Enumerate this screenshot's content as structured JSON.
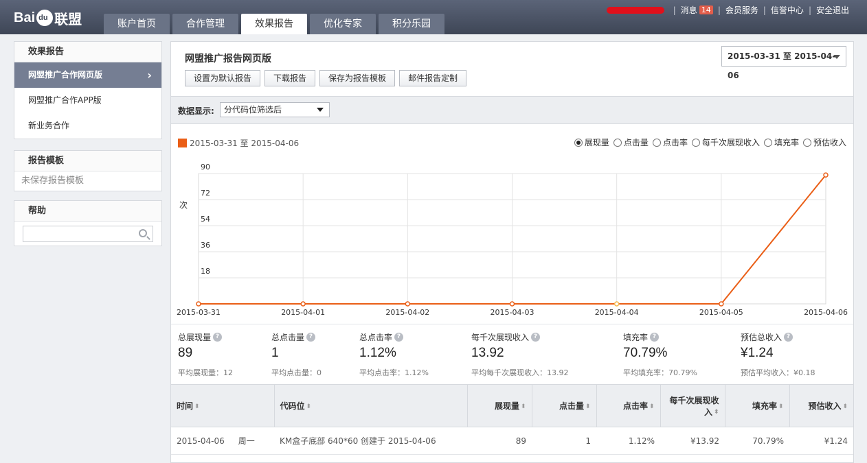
{
  "brand": {
    "left": "Bai",
    "right": "联盟"
  },
  "nav": {
    "tabs": [
      {
        "label": "账户首页"
      },
      {
        "label": "合作管理"
      },
      {
        "label": "效果报告"
      },
      {
        "label": "优化专家"
      },
      {
        "label": "积分乐园"
      }
    ],
    "active_tab": "效果报告"
  },
  "topright": {
    "messages_label": "消息",
    "messages_count": "14",
    "member_service": "会员服务",
    "credit_center": "信誉中心",
    "logout": "安全退出"
  },
  "sidebar": {
    "report": {
      "head": "效果报告",
      "items": [
        {
          "label": "网盟推广合作网页版"
        },
        {
          "label": "网盟推广合作APP版"
        },
        {
          "label": "新业务合作"
        }
      ]
    },
    "template": {
      "head": "报告模板",
      "empty_text": "未保存报告模板"
    },
    "help": {
      "head": "帮助",
      "search_placeholder": ""
    }
  },
  "main": {
    "title": "网盟推广报告网页版",
    "buttons": [
      "设置为默认报告",
      "下载报告",
      "保存为报告模板",
      "邮件报告定制"
    ],
    "date_range": "2015-03-31 至 2015-04-06",
    "filter_label": "数据显示:",
    "filter_value": "分代码位筛选后",
    "legend_label": "2015-03-31 至 2015-04-06",
    "metric_options": [
      "展现量",
      "点击量",
      "点击率",
      "每千次展现收入",
      "填充率",
      "预估收入"
    ],
    "selected_metric": "展现量"
  },
  "chart_data": {
    "type": "line",
    "ylabel": "次",
    "x": [
      "2015-03-31",
      "2015-04-01",
      "2015-04-02",
      "2015-04-03",
      "2015-04-04",
      "2015-04-05",
      "2015-04-06"
    ],
    "series": [
      {
        "name": "2015-03-31 至 2015-04-06",
        "values": [
          0,
          0,
          0,
          0,
          0,
          0,
          89
        ],
        "color": "#ea5e16"
      }
    ],
    "yticks": [
      18,
      36,
      54,
      72,
      90
    ],
    "ylim": [
      0,
      90
    ],
    "grid": true
  },
  "stats": [
    {
      "name": "总展现量",
      "value": "89",
      "sub": "平均展现量：12"
    },
    {
      "name": "总点击量",
      "value": "1",
      "sub": "平均点击量：0"
    },
    {
      "name": "总点击率",
      "value": "1.12%",
      "sub": "平均点击率：1.12%"
    },
    {
      "name": "每千次展现收入",
      "value": "13.92",
      "sub": "平均每千次展现收入：13.92"
    },
    {
      "name": "填充率",
      "value": "70.79%",
      "sub": "平均填充率：70.79%"
    },
    {
      "name": "预估总收入",
      "value": "¥1.24",
      "sub": "预估平均收入：¥0.18"
    }
  ],
  "table": {
    "headers": [
      "时间",
      "代码位",
      "展现量",
      "点击量",
      "点击率",
      "每千次展现收入",
      "填充率",
      "预估收入"
    ],
    "rows": [
      {
        "date": "2015-04-06",
        "weekday": "周一",
        "slot": "KM盒子底部 640*60 创建于 2015-04-06",
        "impressions": "89",
        "clicks": "1",
        "ctr": "1.12%",
        "rpm": "¥13.92",
        "fill": "70.79%",
        "revenue": "¥1.24"
      }
    ]
  }
}
